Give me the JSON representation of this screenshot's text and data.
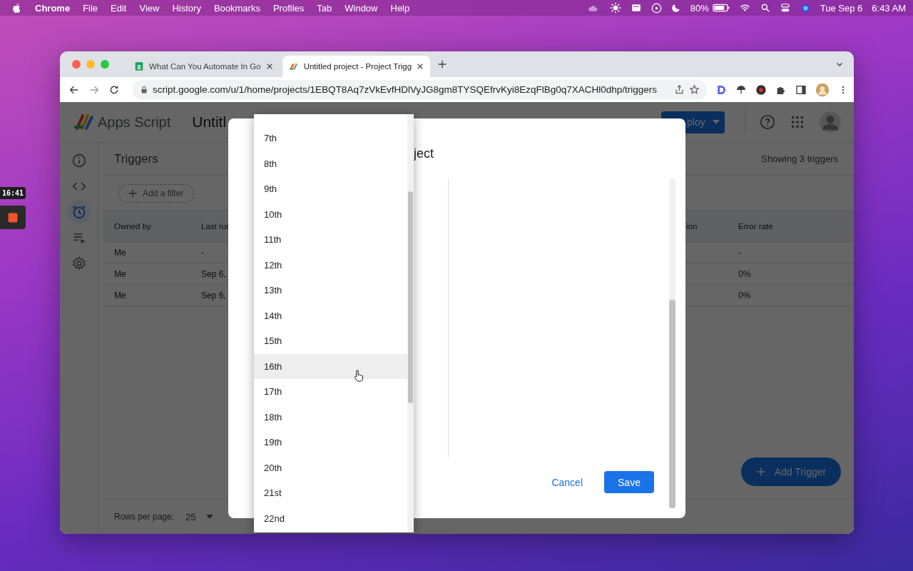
{
  "menubar": {
    "app": "Chrome",
    "menus": [
      "File",
      "Edit",
      "View",
      "History",
      "Bookmarks",
      "Profiles",
      "Tab",
      "Window",
      "Help"
    ],
    "battery": "80%",
    "date": "Tue Sep 6",
    "time": "6:43 AM"
  },
  "recorder": {
    "elapsed": "16:41"
  },
  "browser": {
    "tabs": [
      {
        "title": "What Can You Automate In Go",
        "kind": "spreadsheet",
        "selected": false
      },
      {
        "title": "Untitled project - Project Trigg",
        "kind": "script",
        "selected": true
      }
    ],
    "url": "script.google.com/u/1/home/projects/1EBQT8Aq7zVkEvfHDlVyJG8gm8TYSQEfrvKyi8EzqFlBg0q7XACHl0dhp/triggers"
  },
  "app": {
    "product": "Apps Script",
    "project": "Untitl",
    "deploy": "ploy",
    "nav": [
      {
        "kind": "overview",
        "selected": false
      },
      {
        "kind": "editor",
        "selected": false
      },
      {
        "kind": "triggers",
        "selected": true
      },
      {
        "kind": "executions",
        "selected": false
      },
      {
        "kind": "settings",
        "selected": false
      }
    ],
    "page_title": "Triggers",
    "count": "Showing 3 triggers",
    "filter": "Add a filter",
    "table": {
      "columns": [
        "Owned by",
        "Last rur",
        "ion",
        "Error rate"
      ],
      "rows": [
        {
          "owned_by": "Me",
          "last_run": "-",
          "error_rate": "-"
        },
        {
          "owned_by": "Me",
          "last_run": "Sep 6,",
          "error_rate": "0%"
        },
        {
          "owned_by": "Me",
          "last_run": "Sep 6,",
          "error_rate": "0%"
        }
      ]
    },
    "rows_per_page_label": "Rows per page:",
    "rows_per_page": "25",
    "fab": "Add Trigger"
  },
  "dialog": {
    "title": "ject",
    "cancel": "Cancel",
    "save": "Save",
    "dropdown": {
      "options": [
        {
          "label": "7th",
          "highlighted": false
        },
        {
          "label": "8th",
          "highlighted": false
        },
        {
          "label": "9th",
          "highlighted": false
        },
        {
          "label": "10th",
          "highlighted": false
        },
        {
          "label": "11th",
          "highlighted": false
        },
        {
          "label": "12th",
          "highlighted": false
        },
        {
          "label": "13th",
          "highlighted": false
        },
        {
          "label": "14th",
          "highlighted": false
        },
        {
          "label": "15th",
          "highlighted": false
        },
        {
          "label": "16th",
          "highlighted": true
        },
        {
          "label": "17th",
          "highlighted": false
        },
        {
          "label": "18th",
          "highlighted": false
        },
        {
          "label": "19th",
          "highlighted": false
        },
        {
          "label": "20th",
          "highlighted": false
        },
        {
          "label": "21st",
          "highlighted": false
        },
        {
          "label": "22nd",
          "highlighted": false
        }
      ]
    }
  }
}
